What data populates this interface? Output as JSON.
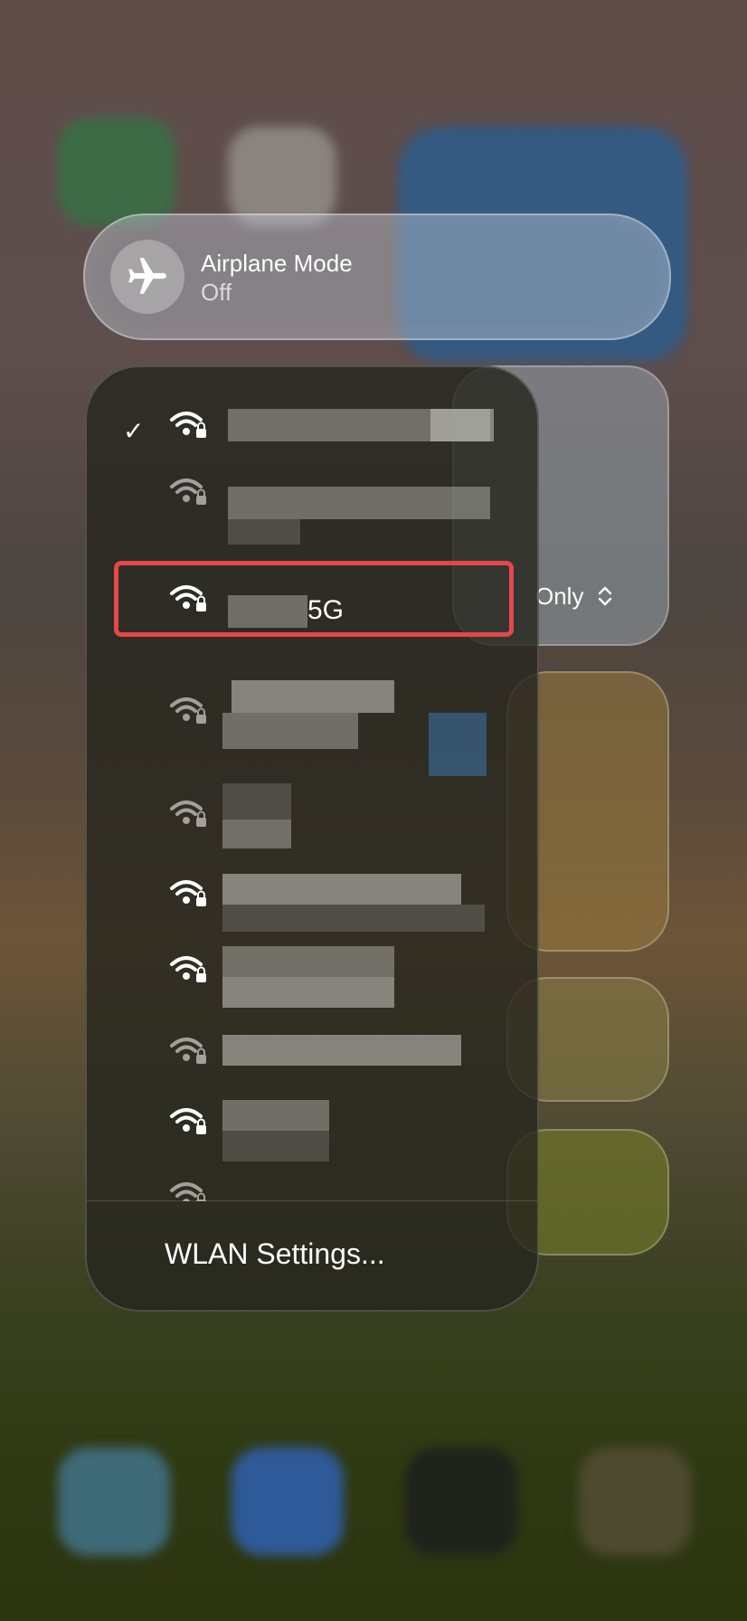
{
  "airplane_mode": {
    "title": "Airplane Mode",
    "status": "Off"
  },
  "focus": {
    "label": "Only"
  },
  "wifi": {
    "networks": [
      {
        "name": "",
        "connected": true,
        "signal": "full",
        "locked": true
      },
      {
        "name": "",
        "connected": false,
        "signal": "weak",
        "locked": true
      },
      {
        "name": "5G",
        "connected": false,
        "signal": "full",
        "locked": true,
        "highlighted": true
      },
      {
        "name": "",
        "connected": false,
        "signal": "weak",
        "locked": true
      },
      {
        "name": "",
        "connected": false,
        "signal": "weak",
        "locked": true
      },
      {
        "name": "",
        "connected": false,
        "signal": "full",
        "locked": true
      },
      {
        "name": "",
        "connected": false,
        "signal": "full",
        "locked": true
      },
      {
        "name": "",
        "connected": false,
        "signal": "weak",
        "locked": true
      },
      {
        "name": "",
        "connected": false,
        "signal": "full",
        "locked": true
      },
      {
        "name": "",
        "connected": false,
        "signal": "weak",
        "locked": true
      }
    ],
    "settings_label": "WLAN Settings..."
  },
  "colors": {
    "highlight": "#e5474b",
    "accent": "#ffffff"
  }
}
